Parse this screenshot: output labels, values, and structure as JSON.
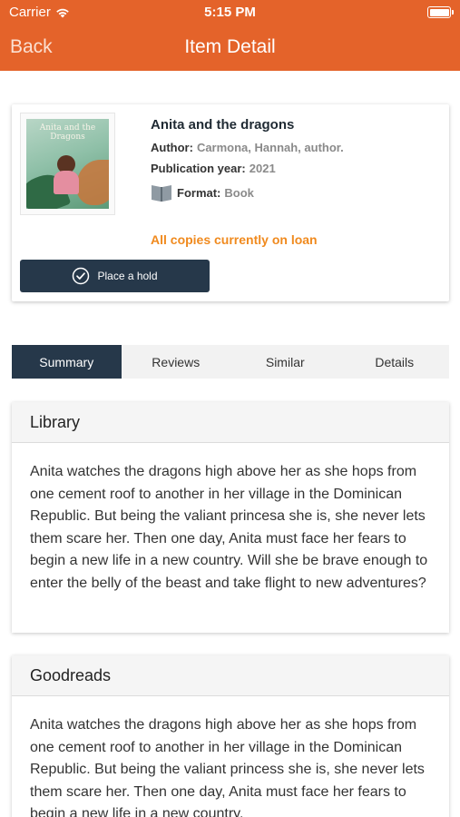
{
  "status_bar": {
    "carrier": "Carrier",
    "time": "5:15 PM"
  },
  "nav": {
    "back_label": "Back",
    "title": "Item Detail"
  },
  "item": {
    "title": "Anita and the dragons",
    "cover_text": "Anita and the Dragons",
    "author_label": "Author:",
    "author": "Carmona, Hannah, author.",
    "year_label": "Publication year:",
    "year": "2021",
    "format_label": "Format:",
    "format": "Book",
    "availability": "All copies currently on loan",
    "hold_label": "Place a hold"
  },
  "tabs": [
    {
      "label": "Summary",
      "active": true
    },
    {
      "label": "Reviews",
      "active": false
    },
    {
      "label": "Similar",
      "active": false
    },
    {
      "label": "Details",
      "active": false
    }
  ],
  "panels": {
    "library": {
      "title": "Library",
      "text": "Anita watches the dragons high above her as she hops from one cement roof to another in her village in the Dominican Republic. But being the valiant princesa she is, she never lets them scare her. Then one day, Anita must face her fears to begin a new life in a new country. Will she be brave enough to enter the belly of the beast and take flight to new adventures?"
    },
    "goodreads": {
      "title": "Goodreads",
      "text": "Anita watches the dragons high above her as she hops from one cement roof to another in her village in the Dominican Republic. But being the valiant princess she is, she never lets them scare her. Then one day, Anita must face her fears to begin a new life in a new country."
    }
  },
  "colors": {
    "brand": "#e4632a",
    "button": "#26384a",
    "availability": "#f08a1e"
  }
}
